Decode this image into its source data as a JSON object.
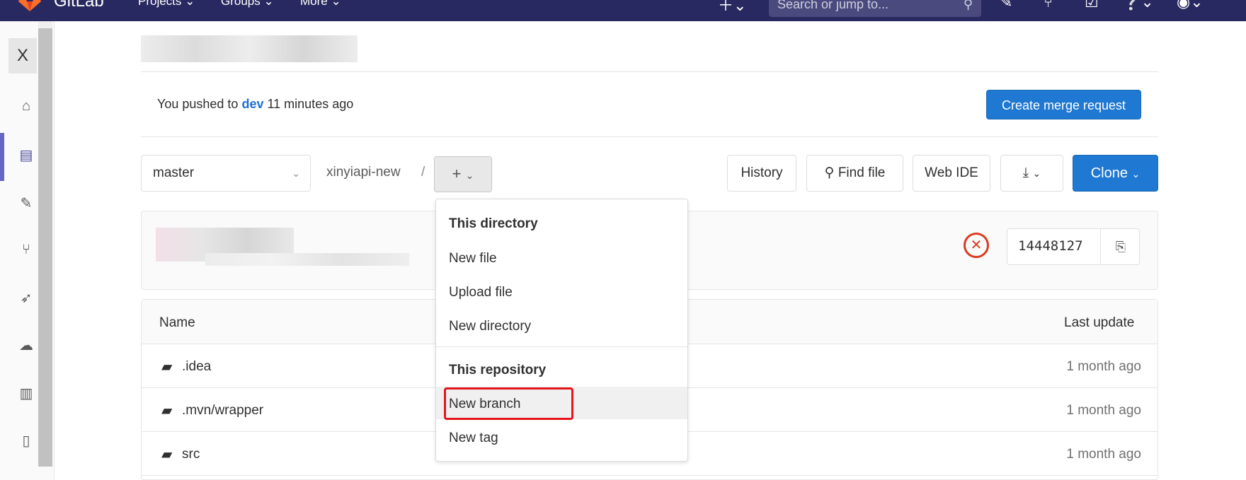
{
  "topbar": {
    "brand": "GitLab",
    "nav": [
      "Projects",
      "Groups",
      "More"
    ],
    "search_placeholder": "Search or jump to..."
  },
  "sidebar": {
    "close_label": "X",
    "icons": [
      "home-icon",
      "file-icon",
      "issues-icon",
      "merge-request-icon",
      "rocket-icon",
      "cloud-icon",
      "chart-icon",
      "book-icon"
    ]
  },
  "push_notice": {
    "prefix": "You pushed to ",
    "branch": "dev",
    "suffix": " 11 minutes ago",
    "button": "Create merge request"
  },
  "toolbar": {
    "branch": "master",
    "project": "xinyiapi-new",
    "separator": "/",
    "plus_label": "+",
    "history": "History",
    "find_file": "Find file",
    "web_ide": "Web IDE",
    "clone": "Clone"
  },
  "commit": {
    "sha": "14448127",
    "status": "failed"
  },
  "table": {
    "col_name": "Name",
    "col_update": "Last update",
    "rows": [
      {
        "name": ".idea",
        "updated": "1 month ago"
      },
      {
        "name": ".mvn/wrapper",
        "updated": "1 month ago"
      },
      {
        "name": "src",
        "updated": "1 month ago"
      }
    ]
  },
  "dropdown": {
    "section1": "This directory",
    "new_file": "New file",
    "upload_file": "Upload file",
    "new_directory": "New directory",
    "section2": "This repository",
    "new_branch": "New branch",
    "new_tag": "New tag"
  },
  "colors": {
    "topbar": "#292961",
    "primary": "#1f78d1",
    "error": "#db3b21",
    "highlight": "#e3141c"
  }
}
